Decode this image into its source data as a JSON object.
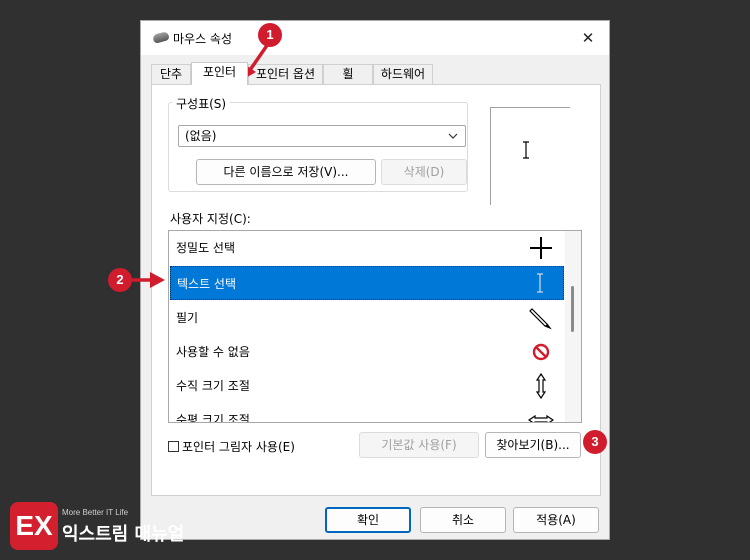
{
  "window": {
    "title": "마우스 속성",
    "close_icon": "✕"
  },
  "tabs": [
    {
      "label": "단추",
      "active": false
    },
    {
      "label": "포인터",
      "active": true
    },
    {
      "label": "포인터 옵션",
      "active": false
    },
    {
      "label": "휠",
      "active": false
    },
    {
      "label": "하드웨어",
      "active": false
    }
  ],
  "scheme": {
    "group_label": "구성표(S)",
    "selected_value": "(없음)",
    "save_as_label": "다른 이름으로 저장(V)...",
    "delete_label": "삭제(D)"
  },
  "preview": {
    "icon": "text-select-ibeam-icon"
  },
  "customize": {
    "label": "사용자 지정(C):",
    "items": [
      {
        "label": "정밀도 선택",
        "icon": "crosshair-icon",
        "selected": false
      },
      {
        "label": "텍스트 선택",
        "icon": "text-select-ibeam-icon",
        "selected": true
      },
      {
        "label": "필기",
        "icon": "pen-icon",
        "selected": false
      },
      {
        "label": "사용할 수 없음",
        "icon": "unavailable-icon",
        "selected": false
      },
      {
        "label": "수직 크기 조절",
        "icon": "vertical-resize-icon",
        "selected": false
      },
      {
        "label": "수평 크기 조절",
        "icon": "horizontal-resize-icon",
        "selected": false
      }
    ]
  },
  "options": {
    "shadow_label": "포인터 그림자 사용(E)",
    "shadow_checked": false,
    "default_label": "기본값 사용(F)",
    "browse_label": "찾아보기(B)..."
  },
  "footer": {
    "ok_label": "확인",
    "cancel_label": "취소",
    "apply_label": "적용(A)"
  },
  "annotations": [
    {
      "number": "1"
    },
    {
      "number": "2"
    },
    {
      "number": "3"
    }
  ],
  "watermark": {
    "logo_letter": "EX",
    "tagline": "More Better IT Life",
    "brand": "익스트림 매뉴얼"
  },
  "colors": {
    "selection": "#0078d7",
    "annotation": "#d01c2c",
    "primary_border": "#0067c0"
  }
}
